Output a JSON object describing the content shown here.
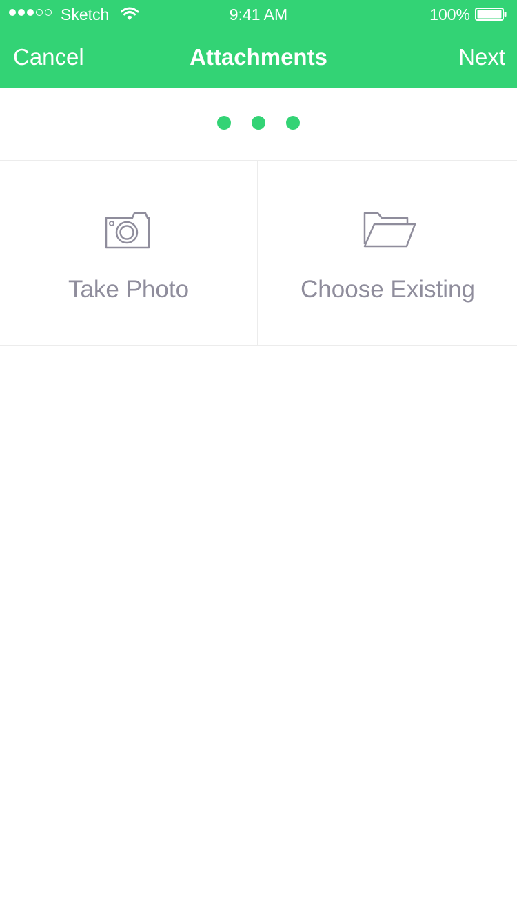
{
  "colors": {
    "accent": "#33d375",
    "icon_gray": "#8f8d9c",
    "divider": "#ececec"
  },
  "status_bar": {
    "signal_bars_filled": 3,
    "signal_bars_total": 5,
    "carrier": "Sketch",
    "time": "9:41 AM",
    "battery_percent": "100%",
    "battery_level": 1.0,
    "icons": [
      "wifi-icon",
      "battery-icon"
    ]
  },
  "nav": {
    "left_label": "Cancel",
    "title": "Attachments",
    "right_label": "Next"
  },
  "pager": {
    "total_pages": 3
  },
  "options": [
    {
      "label": "Take Photo",
      "icon": "camera-icon"
    },
    {
      "label": "Choose Existing",
      "icon": "folder-icon"
    }
  ]
}
